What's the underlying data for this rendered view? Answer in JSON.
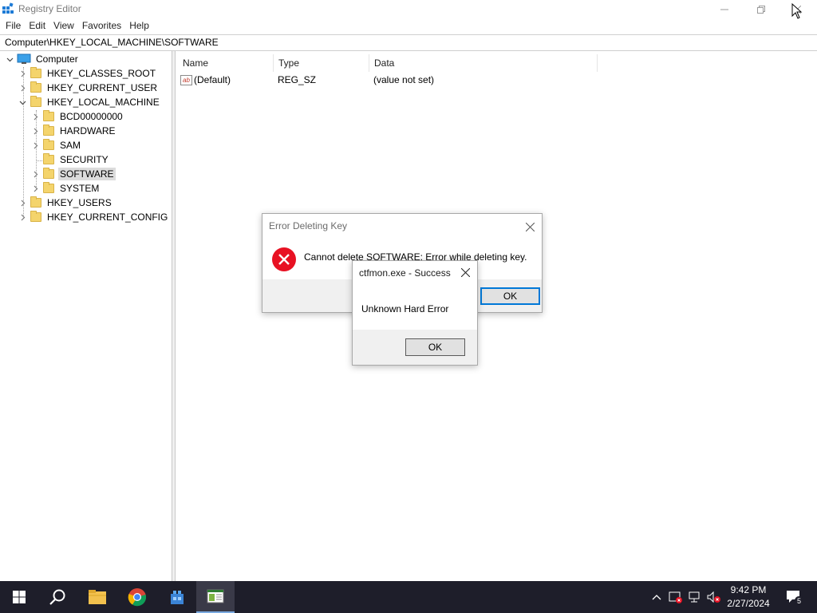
{
  "window": {
    "title": "Registry Editor",
    "minimize_icon": "minimize-icon",
    "restore_icon": "restore-icon",
    "close_icon": "close-icon"
  },
  "menu": [
    "File",
    "Edit",
    "View",
    "Favorites",
    "Help"
  ],
  "address": "Computer\\HKEY_LOCAL_MACHINE\\SOFTWARE",
  "tree": {
    "root": "Computer",
    "hives": {
      "classes_root": "HKEY_CLASSES_ROOT",
      "current_user": "HKEY_CURRENT_USER",
      "local_machine": "HKEY_LOCAL_MACHINE",
      "users": "HKEY_USERS",
      "current_config": "HKEY_CURRENT_CONFIG"
    },
    "local_machine_children": {
      "bcd": "BCD00000000",
      "hardware": "HARDWARE",
      "sam": "SAM",
      "security": "SECURITY",
      "software": "SOFTWARE",
      "system": "SYSTEM"
    },
    "selected": "SOFTWARE"
  },
  "list": {
    "columns": {
      "name": "Name",
      "type": "Type",
      "data": "Data"
    },
    "rows": [
      {
        "name": "(Default)",
        "type": "REG_SZ",
        "data": "(value not set)"
      }
    ]
  },
  "error_dialog": {
    "title": "Error Deleting Key",
    "message": "Cannot delete SOFTWARE:  Error while deleting key.",
    "ok": "OK"
  },
  "ctfmon_dialog": {
    "title": "ctfmon.exe - Success",
    "message": "Unknown Hard Error",
    "ok": "OK"
  },
  "taskbar": {
    "time": "9:42 PM",
    "date": "2/27/2024",
    "notification_count": "5"
  },
  "colors": {
    "taskbar_bg": "#1e1e2a",
    "accent": "#0078d7",
    "error_red": "#e81123",
    "folder": "#f4d46c"
  }
}
